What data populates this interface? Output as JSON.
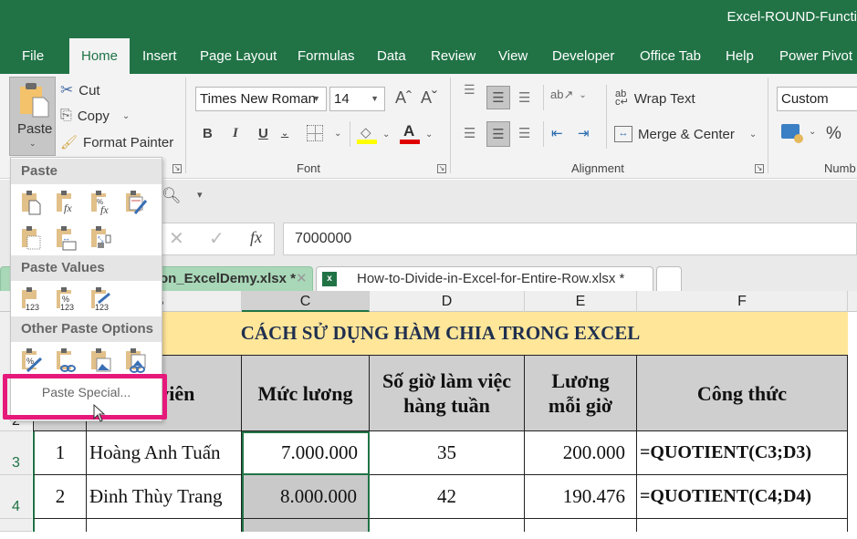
{
  "window": {
    "title": "Excel-ROUND-Functi"
  },
  "tabs": [
    {
      "label": "File"
    },
    {
      "label": "Home",
      "active": true
    },
    {
      "label": "Insert"
    },
    {
      "label": "Page Layout"
    },
    {
      "label": "Formulas"
    },
    {
      "label": "Data"
    },
    {
      "label": "Review"
    },
    {
      "label": "View"
    },
    {
      "label": "Developer"
    },
    {
      "label": "Office Tab"
    },
    {
      "label": "Help"
    },
    {
      "label": "Power Pivot"
    }
  ],
  "clipboard": {
    "paste_label": "Paste",
    "cut_label": "Cut",
    "copy_label": "Copy",
    "format_painter_label": "Format Painter"
  },
  "font": {
    "group_label": "Font",
    "font_name": "Times New Roman",
    "font_size": "14",
    "bold": "B",
    "italic": "I",
    "underline": "U",
    "fill_color": "#ffff00",
    "font_color": "#e00000"
  },
  "alignment": {
    "group_label": "Alignment",
    "wrap_text_label": "Wrap Text",
    "merge_center_label": "Merge & Center"
  },
  "number": {
    "group_label": "Numb",
    "format": "Custom",
    "percent": "%"
  },
  "formula_bar": {
    "value": "7000000",
    "fx": "fx"
  },
  "doc_tabs": [
    {
      "label": "on_ExcelDemy.xlsx *",
      "active": true
    },
    {
      "label": "How-to-Divide-in-Excel-for-Entire-Row.xlsx *",
      "active": false
    }
  ],
  "paste_menu": {
    "section_paste": "Paste",
    "section_paste_values": "Paste Values",
    "section_other": "Other Paste Options",
    "paste_special": "Paste Special...",
    "paste_icons": [
      "paste-icon",
      "paste-formulas-icon",
      "paste-formulas-number-format-icon",
      "keep-source-formatting-icon",
      "no-borders-icon",
      "keep-column-widths-icon",
      "transpose-icon"
    ],
    "values_icons": [
      "paste-values-icon",
      "values-number-format-icon",
      "values-source-formatting-icon"
    ],
    "other_icons": [
      "formatting-icon",
      "paste-link-icon",
      "picture-icon",
      "linked-picture-icon"
    ]
  },
  "sheet": {
    "columns": [
      "B",
      "C",
      "D",
      "E",
      "F"
    ],
    "row_numbers": [
      "2",
      "3",
      "4"
    ],
    "title": "CÁCH SỬ DỤNG HÀM CHIA TRONG EXCEL",
    "headers": [
      "ân viên",
      "Mức lương",
      "Số giờ làm việc hàng tuần",
      "Lương mỗi giờ",
      "Công thức"
    ],
    "rows": [
      {
        "stt": "1",
        "name": "Hoàng Anh Tuấn",
        "salary": "7.000.000",
        "hours": "35",
        "hourly": "200.000",
        "formula": "=QUOTIENT(C3;D3)"
      },
      {
        "stt": "2",
        "name": "Đinh Thùy Trang",
        "salary": "8.000.000",
        "hours": "42",
        "hourly": "190.476",
        "formula": "=QUOTIENT(C4;D4)"
      }
    ]
  },
  "colors": {
    "brand": "#217346",
    "banner": "#ffe699",
    "header_fill": "#cfcfcf",
    "highlight": "#e6197a"
  }
}
